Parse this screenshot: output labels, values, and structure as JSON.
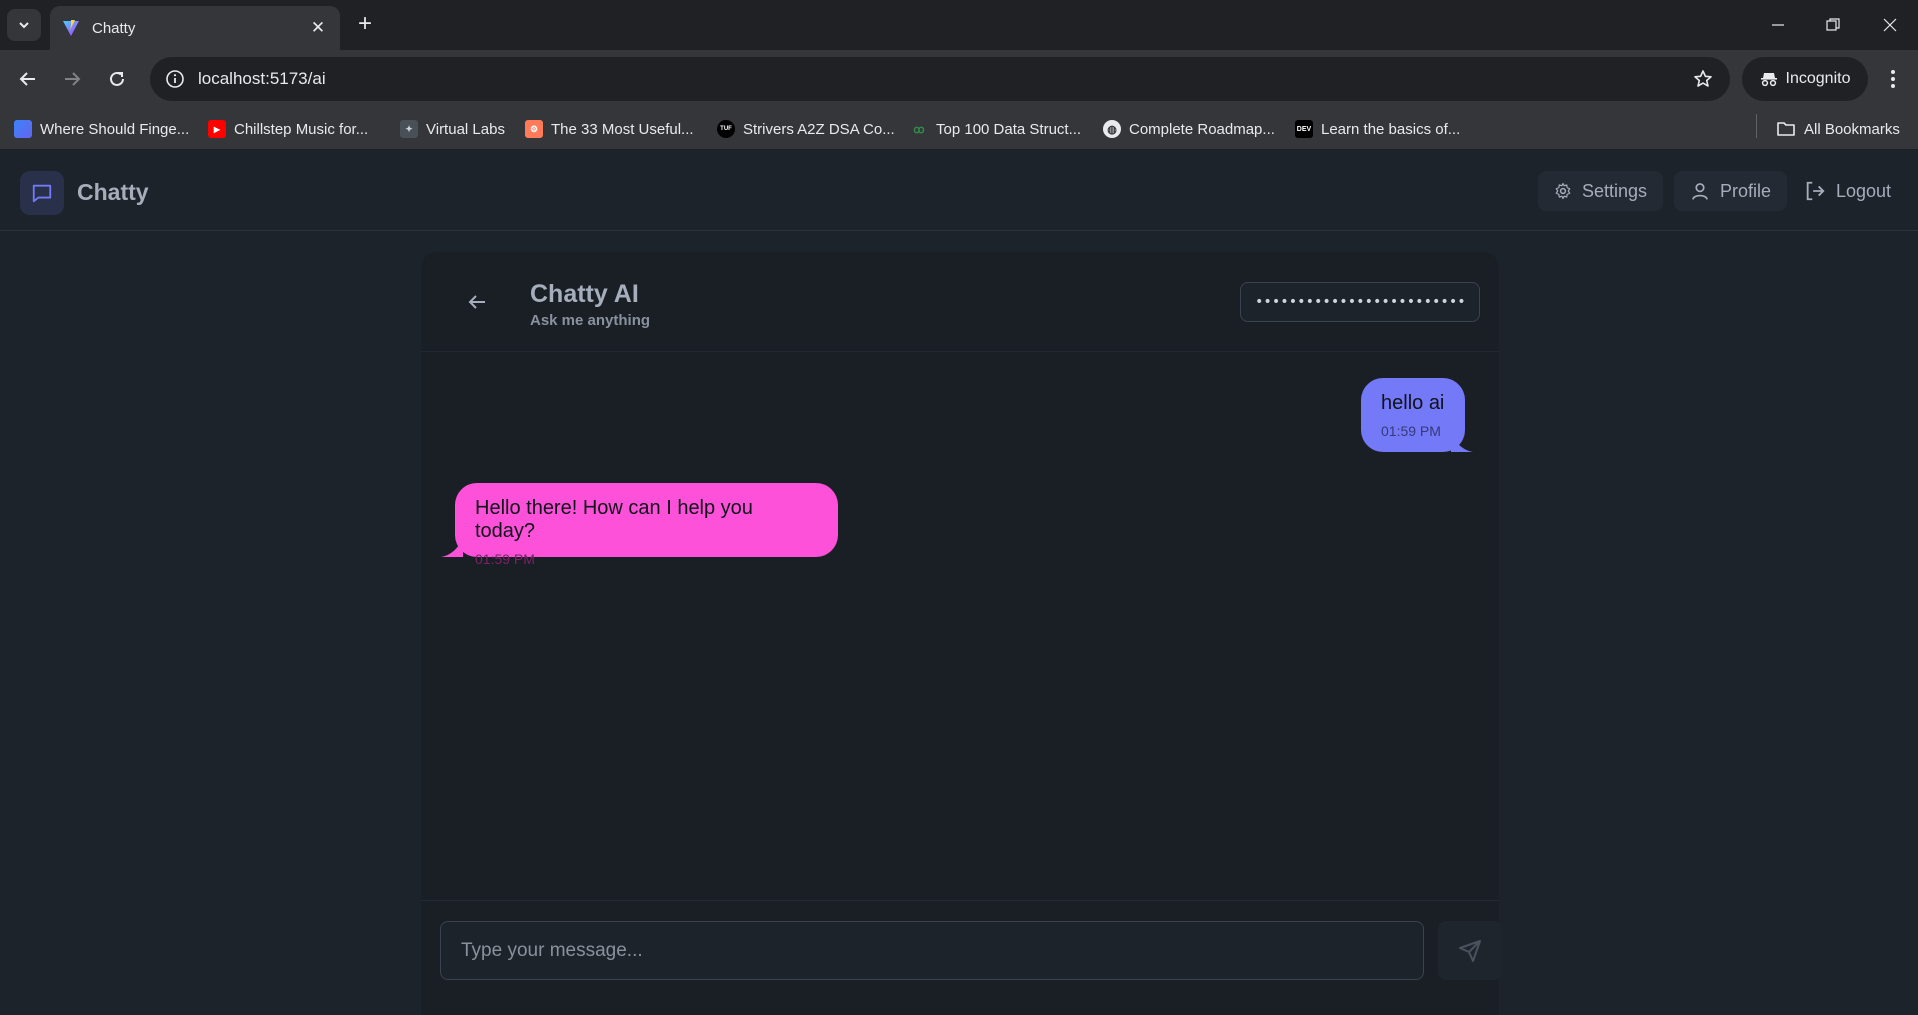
{
  "browser": {
    "tab_title": "Chatty",
    "url": "localhost:5173/ai",
    "incognito_label": "Incognito",
    "bookmarks": [
      {
        "label": "Where Should Finge...",
        "icon": "gradient-icon"
      },
      {
        "label": "Chillstep Music for...",
        "icon": "youtube-icon"
      },
      {
        "label": "Virtual Labs",
        "icon": "virtual-labs-icon"
      },
      {
        "label": "The 33 Most Useful...",
        "icon": "hubspot-icon"
      },
      {
        "label": "Strivers A2Z DSA Co...",
        "icon": "tuf-icon"
      },
      {
        "label": "Top 100 Data Struct...",
        "icon": "gfg-icon"
      },
      {
        "label": "Complete Roadmap...",
        "icon": "globe-icon"
      },
      {
        "label": "Learn the basics of...",
        "icon": "dev-icon"
      }
    ],
    "all_bookmarks_label": "All Bookmarks"
  },
  "header": {
    "app_name": "Chatty",
    "settings_label": "Settings",
    "profile_label": "Profile",
    "logout_label": "Logout"
  },
  "chat": {
    "title": "Chatty AI",
    "subtitle": "Ask me anything",
    "api_key_value": "••••••••••••••••••••••••••••••••",
    "messages": [
      {
        "role": "user",
        "text": "hello ai",
        "time": "01:59 PM"
      },
      {
        "role": "ai",
        "text": "Hello there! How can I help you today?",
        "time": "01:59 PM"
      }
    ],
    "input_placeholder": "Type your message..."
  },
  "colors": {
    "user_bubble": "#7479f7",
    "ai_bubble": "#fd51d9",
    "background": "#1d232a"
  }
}
